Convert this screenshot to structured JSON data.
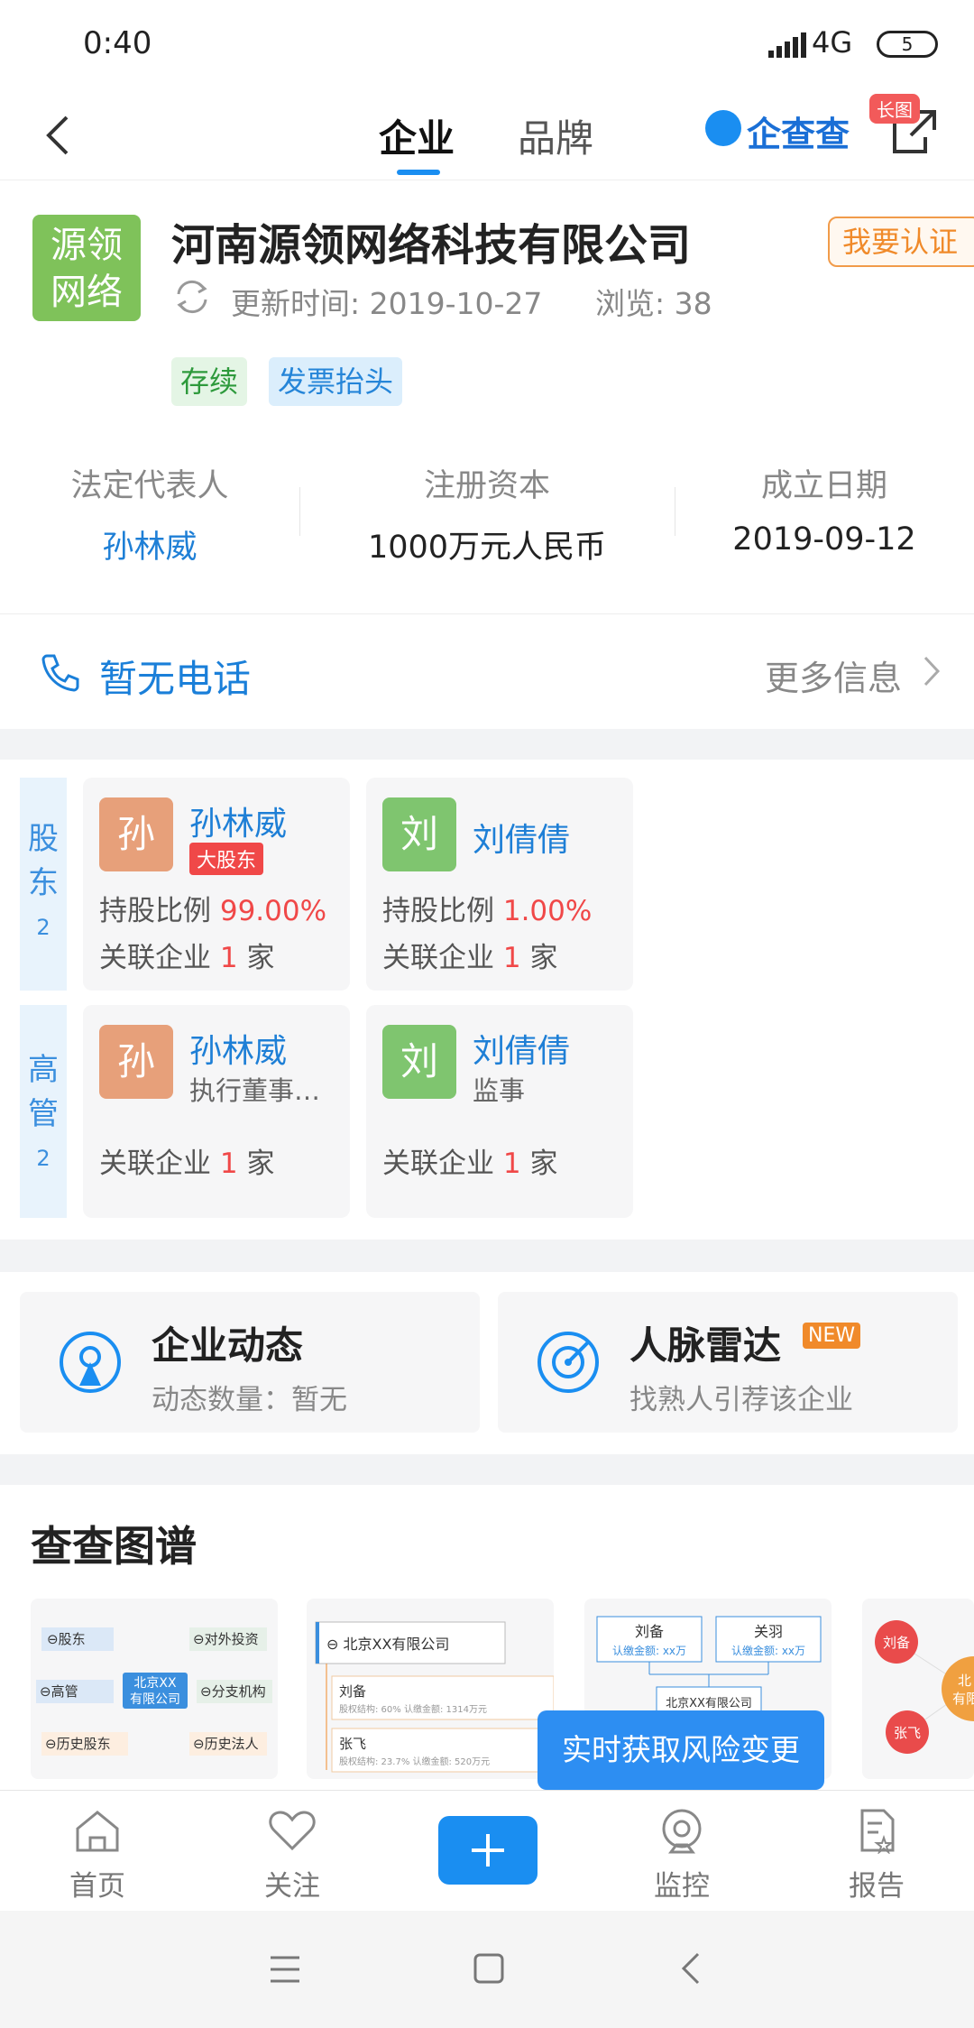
{
  "status_bar": {
    "time": "0:40",
    "network": "4G",
    "battery": "5"
  },
  "header": {
    "tabs": [
      {
        "label": "企业"
      },
      {
        "label": "品牌"
      }
    ],
    "brand_logo": "企查查",
    "long_image_badge": "长图"
  },
  "company": {
    "logo_text_line1": "源领",
    "logo_text_line2": "网络",
    "name": "河南源领网络科技有限公司",
    "certify_button": "我要认证",
    "update_time": "更新时间: 2019-10-27",
    "views": "浏览: 38",
    "tags": [
      "存续",
      "发票抬头"
    ],
    "info": [
      {
        "label": "法定代表人",
        "value": "孙林威"
      },
      {
        "label": "注册资本",
        "value": "1000万元人民币"
      },
      {
        "label": "成立日期",
        "value": "2019-09-12"
      }
    ]
  },
  "phone": {
    "text": "暂无电话",
    "more": "更多信息"
  },
  "shareholders": {
    "label_chars": [
      "股",
      "东"
    ],
    "count": "2",
    "items": [
      {
        "avatar": "孙",
        "name": "孙林威",
        "badge": "大股东",
        "ratio_label": "持股比例",
        "ratio": "99.00%",
        "rel_prefix": "关联企业",
        "rel_count": "1",
        "rel_suffix": "家"
      },
      {
        "avatar": "刘",
        "name": "刘倩倩",
        "ratio_label": "持股比例",
        "ratio": "1.00%",
        "rel_prefix": "关联企业",
        "rel_count": "1",
        "rel_suffix": "家"
      }
    ]
  },
  "executives": {
    "label_chars": [
      "高",
      "管"
    ],
    "count": "2",
    "items": [
      {
        "avatar": "孙",
        "name": "孙林威",
        "role": "执行董事兼...",
        "rel_prefix": "关联企业",
        "rel_count": "1",
        "rel_suffix": "家"
      },
      {
        "avatar": "刘",
        "name": "刘倩倩",
        "role": "监事",
        "rel_prefix": "关联企业",
        "rel_count": "1",
        "rel_suffix": "家"
      }
    ]
  },
  "dynamics": {
    "news": {
      "title": "企业动态",
      "sub": "动态数量：暂无"
    },
    "radar": {
      "title": "人脉雷达",
      "badge": "NEW",
      "sub": "找熟人引荐该企业"
    }
  },
  "graph_section": {
    "title": "查查图谱",
    "g1": {
      "center": "北京XX\n有限公司",
      "nodes": [
        "⊖股东",
        "⊖对外投资",
        "⊖高管",
        "⊖分支机构",
        "⊖历史股东",
        "⊖历史法人"
      ]
    },
    "g2": {
      "company": "⊖ 北京XX有限公司",
      "p1": "刘备",
      "p1_detail": "股权结构: 60%   认缴金额: 1314万元",
      "p2": "张飞",
      "p2_detail": "股权结构: 23.7%   认缴金额: 520万元"
    },
    "g3": {
      "p1": "刘备",
      "p1_sub": "认缴金额: xx万",
      "p2": "关羽",
      "p2_sub": "认缴金额: xx万",
      "company": "北京XX有限公司"
    },
    "g4": {
      "p1": "刘备",
      "p2": "张飞",
      "company": "北\n有限"
    }
  },
  "tooltip": "实时获取风险变更",
  "tabbar": [
    {
      "label": "首页",
      "icon": "home-icon"
    },
    {
      "label": "关注",
      "icon": "heart-icon"
    },
    {
      "label": "",
      "icon": "plus-icon"
    },
    {
      "label": "监控",
      "icon": "camera-icon"
    },
    {
      "label": "报告",
      "icon": "report-icon"
    }
  ],
  "colors": {
    "accent": "#1a8ef1",
    "red": "#f04848",
    "orange": "#f08a2a",
    "green": "#7fc25a"
  }
}
